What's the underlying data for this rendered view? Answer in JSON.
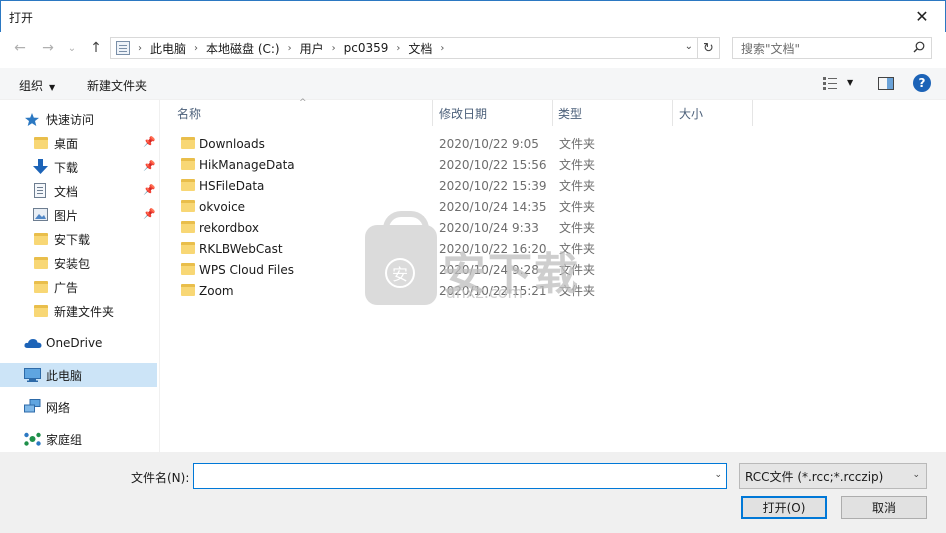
{
  "window": {
    "title": "打开",
    "close": "✕"
  },
  "nav": {
    "back": "←",
    "forward": "→",
    "recent": "⌄",
    "up": "↑",
    "breadcrumbs": [
      "此电脑",
      "本地磁盘 (C:)",
      "用户",
      "pc0359",
      "文档"
    ],
    "crumb_sep": "›",
    "dropdown": "⌄",
    "refresh": "↻",
    "search_placeholder": "搜索\"文档\""
  },
  "toolbar": {
    "organize": "组织",
    "organize_caret": "▼",
    "new_folder": "新建文件夹",
    "view_caret": "▼",
    "help": "?"
  },
  "sidebar": {
    "quick_access": "快速访问",
    "quick_items": [
      {
        "label": "桌面",
        "pinned": "📌"
      },
      {
        "label": "下载",
        "pinned": "📌"
      },
      {
        "label": "文档",
        "pinned": "📌"
      },
      {
        "label": "图片",
        "pinned": "📌"
      },
      {
        "label": "安下载"
      },
      {
        "label": "安装包"
      },
      {
        "label": "广告"
      },
      {
        "label": "新建文件夹"
      }
    ],
    "onedrive": "OneDrive",
    "this_pc": "此电脑",
    "network": "网络",
    "homegroup": "家庭组"
  },
  "columns": {
    "name": "名称",
    "date": "修改日期",
    "type": "类型",
    "size": "大小",
    "sort_arrow": "^"
  },
  "files": [
    {
      "name": "Downloads",
      "date": "2020/10/22 9:05",
      "type": "文件夹"
    },
    {
      "name": "HikManageData",
      "date": "2020/10/22 15:56",
      "type": "文件夹"
    },
    {
      "name": "HSFileData",
      "date": "2020/10/22 15:39",
      "type": "文件夹"
    },
    {
      "name": "okvoice",
      "date": "2020/10/24 14:35",
      "type": "文件夹"
    },
    {
      "name": "rekordbox",
      "date": "2020/10/24 9:33",
      "type": "文件夹"
    },
    {
      "name": "RKLBWebCast",
      "date": "2020/10/22 16:20",
      "type": "文件夹"
    },
    {
      "name": "WPS Cloud Files",
      "date": "2020/10/24 9:28",
      "type": "文件夹"
    },
    {
      "name": "Zoom",
      "date": "2020/10/22 15:21",
      "type": "文件夹"
    }
  ],
  "watermark": {
    "char": "安",
    "text": "安下载",
    "sub": "anxz.com"
  },
  "footer": {
    "filename_label": "文件名(N):",
    "filename_value": "",
    "filetype": "RCC文件 (*.rcc;*.rcczip)",
    "dd": "⌄",
    "open": "打开(O)",
    "cancel": "取消"
  }
}
